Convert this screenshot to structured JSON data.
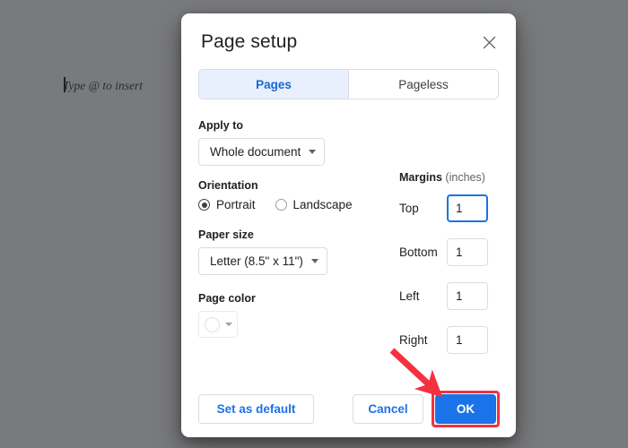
{
  "document": {
    "placeholder_text": "Type @ to insert",
    "caret_icon": "text-caret"
  },
  "dialog": {
    "title": "Page setup",
    "close_icon": "close-icon",
    "tabs": [
      {
        "label": "Pages",
        "active": true
      },
      {
        "label": "Pageless",
        "active": false
      }
    ],
    "apply_to": {
      "label": "Apply to",
      "value": "Whole document",
      "caret_icon": "chevron-down-icon"
    },
    "orientation": {
      "label": "Orientation",
      "options": [
        {
          "label": "Portrait",
          "selected": true
        },
        {
          "label": "Landscape",
          "selected": false
        }
      ]
    },
    "paper_size": {
      "label": "Paper size",
      "value": "Letter (8.5\" x 11\")",
      "caret_icon": "chevron-down-icon"
    },
    "page_color": {
      "label": "Page color",
      "swatch_color": "#ffffff",
      "swatch_icon": "color-circle-icon",
      "caret_icon": "chevron-down-icon"
    },
    "margins": {
      "title_bold": "Margins",
      "title_unit": "(inches)",
      "rows": [
        {
          "label": "Top",
          "value": "1",
          "focused": true
        },
        {
          "label": "Bottom",
          "value": "1",
          "focused": false
        },
        {
          "label": "Left",
          "value": "1",
          "focused": false
        },
        {
          "label": "Right",
          "value": "1",
          "focused": false
        }
      ]
    },
    "footer": {
      "set_default_label": "Set as default",
      "cancel_label": "Cancel",
      "ok_label": "OK"
    }
  },
  "annotation": {
    "arrow_icon": "red-arrow-pointer",
    "highlight_icon": "red-highlight-box",
    "accent_red": "#f4313f",
    "accent_blue": "#1a73e8",
    "tab_active_bg": "#e8f0fe",
    "tab_active_text": "#1967d2"
  }
}
